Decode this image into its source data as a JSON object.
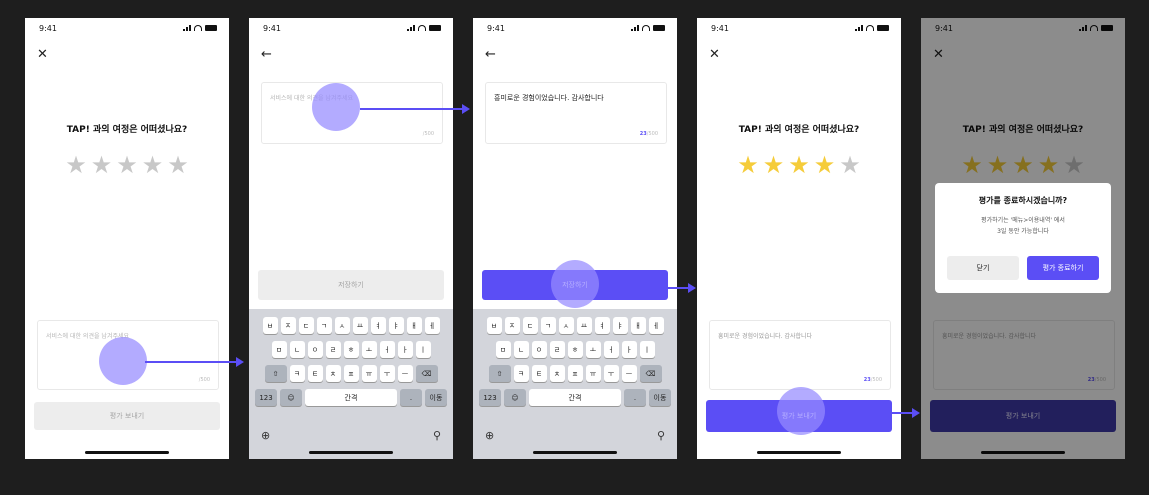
{
  "status_time": "9:41",
  "question": "TAP! 과의 여정은 어떠셨나요?",
  "review_placeholder": "서비스에 대한 의견을 남겨주세요",
  "review_text": "흥미로운 경험이었습니다. 감사합니다",
  "char_counter": {
    "count": "23",
    "unit": "/500"
  },
  "counter_suffix": "/500",
  "buttons": {
    "send": "평가 보내기",
    "save": "저장하기"
  },
  "keyboard": {
    "row1": [
      "ㅂ",
      "ㅈ",
      "ㄷ",
      "ㄱ",
      "ㅅ",
      "ㅛ",
      "ㅕ",
      "ㅑ",
      "ㅐ",
      "ㅔ"
    ],
    "row2": [
      "ㅁ",
      "ㄴ",
      "ㅇ",
      "ㄹ",
      "ㅎ",
      "ㅗ",
      "ㅓ",
      "ㅏ",
      "ㅣ"
    ],
    "row3": [
      "ㅋ",
      "ㅌ",
      "ㅊ",
      "ㅍ",
      "ㅠ",
      "ㅜ",
      "ㅡ"
    ],
    "shift": "⇧",
    "backspace": "⌫",
    "num": "123",
    "emoji": "☺",
    "space": "간격",
    "period": ".",
    "return": "이동",
    "globe": "⊕",
    "mic": "⚲"
  },
  "ratings": {
    "initial": 0,
    "selected": 4,
    "max": 5
  },
  "modal": {
    "title": "평가를 종료하시겠습니까?",
    "body_line1": "평가하기는 '메뉴>이용내역' 에서",
    "body_line2": "3일 동안 가능합니다",
    "close": "닫기",
    "confirm": "평가 종료하기"
  },
  "icons": {
    "close": "close-icon",
    "back": "back-arrow-icon",
    "star": "star-icon"
  },
  "colors": {
    "accent": "#5b4ef5",
    "star_on": "#f5cc3a",
    "star_off": "#c8c8c8",
    "background": "#1e1e1e"
  }
}
